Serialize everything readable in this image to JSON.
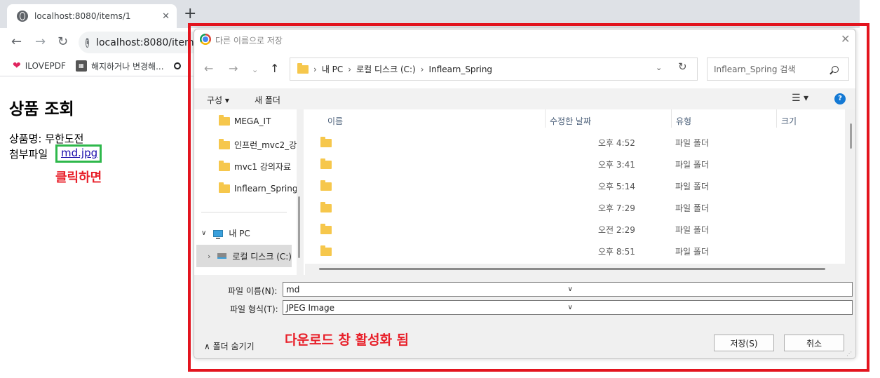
{
  "browser": {
    "tab_title": "localhost:8080/items/1",
    "new_tab": "+",
    "url": "localhost:8080/items/",
    "bookmarks": [
      {
        "label": "ILOVEPDF",
        "icon": "heart-icon"
      },
      {
        "label": "해지하거나 변경해...",
        "icon": "bookmark-image-icon"
      }
    ]
  },
  "page": {
    "title": "상품 조회",
    "product_name": "상품명: 무한도전",
    "attachment_label": "첨부파일",
    "attachment_link": "md.jpg",
    "annotation_click": "클릭하면",
    "annotation_download": "다운로드 창 활성화 됨",
    "annotation_colors": {
      "red": "#e3141e",
      "green": "#2eb84b"
    }
  },
  "dialog": {
    "title": "다른 이름으로 저장",
    "breadcrumbs": [
      "내 PC",
      "로컬 디스크 (C:)",
      "Inflearn_Spring"
    ],
    "search_placeholder": "Inflearn_Spring 검색",
    "organize": "구성 ▾",
    "new_folder": "새 폴더",
    "help": "?",
    "nav_items": [
      "MEGA_IT",
      "인프런_mvc2_강",
      "mvc1 강의자료",
      "Inflearn_Spring"
    ],
    "this_pc": "내 PC",
    "local_disk": "로컬 디스크 (C:)",
    "columns": {
      "name": "이름",
      "date": "수정한 날짜",
      "type": "유형",
      "size": "크기"
    },
    "files": [
      {
        "date": "오후 4:52",
        "type": "파일 폴더"
      },
      {
        "date": "오후 3:41",
        "type": "파일 폴더"
      },
      {
        "date": "오후 5:14",
        "type": "파일 폴더"
      },
      {
        "date": "오후 7:29",
        "type": "파일 폴더"
      },
      {
        "date": "오전 2:29",
        "type": "파일 폴더"
      },
      {
        "date": "오후 8:51",
        "type": "파일 폴더"
      }
    ],
    "filename_label": "파일 이름(N):",
    "filename_value": "md",
    "filetype_label": "파일 형식(T):",
    "filetype_value": "JPEG Image",
    "hide_folders": "폴더 숨기기",
    "save_button": "저장(S)",
    "cancel_button": "취소"
  }
}
